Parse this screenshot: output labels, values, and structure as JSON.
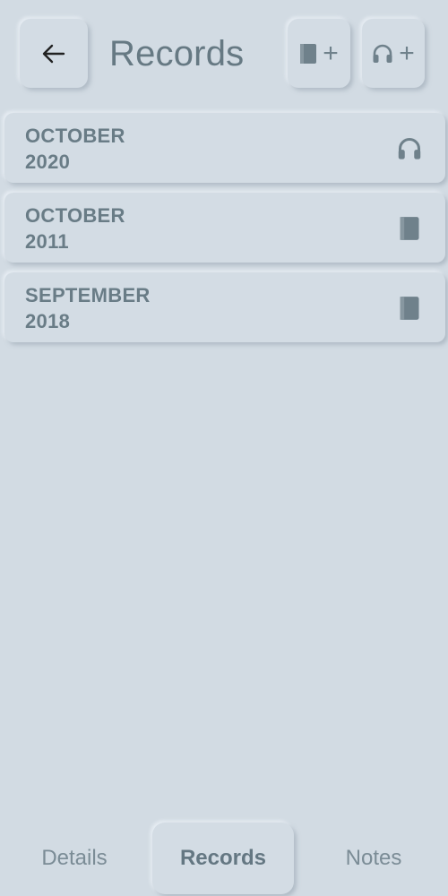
{
  "header": {
    "title": "Records",
    "back_icon": "arrow-left-icon",
    "add_book": {
      "icon": "book-icon",
      "plus": "+"
    },
    "add_audio": {
      "icon": "headphones-icon",
      "plus": "+"
    }
  },
  "records": [
    {
      "month": "OCTOBER",
      "year": "2020",
      "type_icon": "headphones-icon"
    },
    {
      "month": "OCTOBER",
      "year": "2011",
      "type_icon": "book-icon"
    },
    {
      "month": "SEPTEMBER",
      "year": "2018",
      "type_icon": "book-icon"
    }
  ],
  "nav": {
    "tabs": [
      {
        "label": "Details",
        "active": false
      },
      {
        "label": "Records",
        "active": true
      },
      {
        "label": "Notes",
        "active": false
      }
    ]
  },
  "colors": {
    "background": "#d2dbe3",
    "text_primary": "#667983",
    "icon": "#6f818b"
  }
}
